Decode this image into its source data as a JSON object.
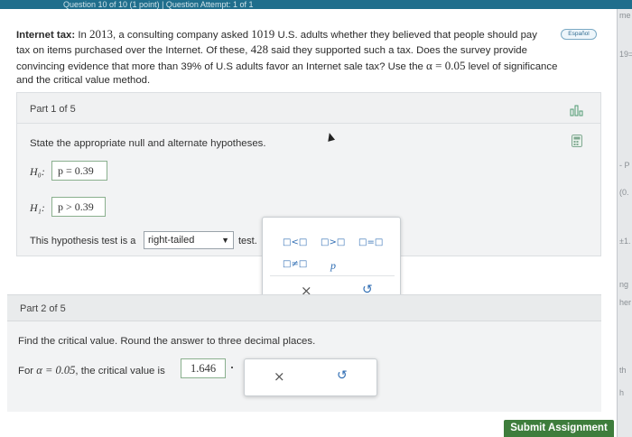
{
  "header": {
    "title": "Question 10 of 10 (1 point) | Question Attempt: 1 of 1"
  },
  "problem": {
    "label": "Internet tax:",
    "text_1": "In",
    "year": "2013",
    "text_2": ", a consulting company asked",
    "n": "1019",
    "text_3": "U.S. adults whether they believed that people should pay",
    "text_4": "tax on items purchased over the Internet. Of these,",
    "x": "428",
    "text_5": "said they supported such a tax. Does the survey provide",
    "text_6": "convincing evidence that more than",
    "pct": "39%",
    "text_7": "of U.S adults favor an Internet sale tax? Use the",
    "alpha_expr": "α = 0.05",
    "text_8": "level of significance",
    "text_9": "and the critical value method.",
    "espanol": "Español"
  },
  "part1": {
    "title": "Part 1 of 5",
    "prompt": "State the appropriate null and alternate hypotheses.",
    "h0_label": "H₀:",
    "h0_value": "p = 0.39",
    "h1_label": "H₁:",
    "h1_value": "p > 0.39",
    "test_text": "This hypothesis test is a",
    "test_select": "right-tailed",
    "test_suffix": "test.",
    "palette": {
      "lt": "□<□",
      "gt": "□>□",
      "eq": "□=□",
      "ne": "□≠□",
      "p": "p",
      "clear": "×",
      "undo": "↺"
    }
  },
  "part2": {
    "title": "Part 2 of 5",
    "prompt": "Find the critical value. Round the answer to three decimal places.",
    "line_prefix": "For",
    "alpha_expr": "α = 0.05",
    "line_suffix": ", the critical value is",
    "answer": "1.646",
    "clear": "×",
    "undo": "↺"
  },
  "submit": {
    "label": "Submit Assignment"
  },
  "right_strip": {
    "t1": "me",
    "t2": "19=0",
    "t3": "- P",
    "t4": "(0.",
    "t5": "±1.",
    "t6": "ng",
    "t7": "her",
    "t8": "th",
    "t9": "h"
  },
  "colors": {
    "accent": "#1f6e8c",
    "submit": "#3e7d3c",
    "link_blue": "#2f6db3",
    "answer_border": "#8ab08e"
  }
}
